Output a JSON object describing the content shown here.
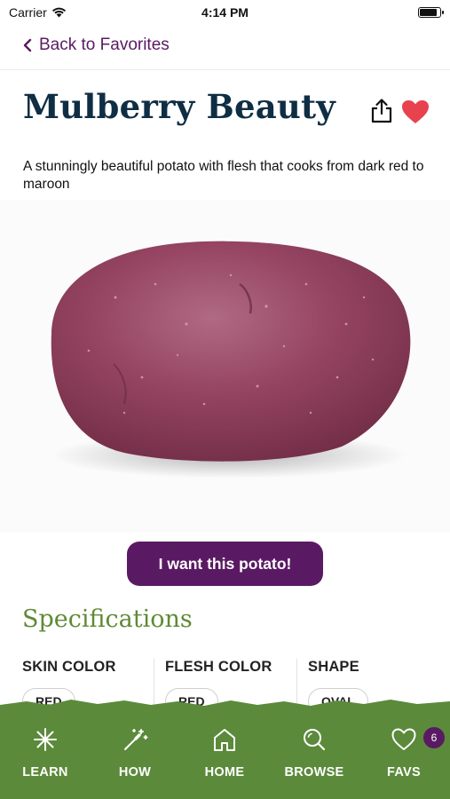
{
  "status": {
    "carrier": "Carrier",
    "time": "4:14 PM",
    "battery_level": 0.9
  },
  "nav": {
    "back_label": "Back to Favorites"
  },
  "potato": {
    "name": "Mulberry Beauty",
    "description": "A stunningly beautiful potato with flesh that cooks from dark red to maroon"
  },
  "cta": {
    "label": "I want this potato!"
  },
  "specifications": {
    "heading": "Specifications",
    "items": [
      {
        "label": "SKIN COLOR",
        "value": "RED"
      },
      {
        "label": "FLESH COLOR",
        "value": "RED"
      },
      {
        "label": "SHAPE",
        "value": "OVAL"
      }
    ]
  },
  "tabs": [
    {
      "label": "LEARN",
      "icon": "sparkle-icon"
    },
    {
      "label": "HOW",
      "icon": "magic-wand-icon"
    },
    {
      "label": "HOME",
      "icon": "home-icon"
    },
    {
      "label": "BROWSE",
      "icon": "search-icon"
    },
    {
      "label": "FAVS",
      "icon": "heart-outline-icon"
    }
  ],
  "favs_badge": "6",
  "colors": {
    "brand_purple": "#5a1a63",
    "title_navy": "#0f2e44",
    "accent_green": "#5f8a35",
    "tab_bar_green": "#5b8a3b",
    "heart_red": "#e8424f"
  }
}
